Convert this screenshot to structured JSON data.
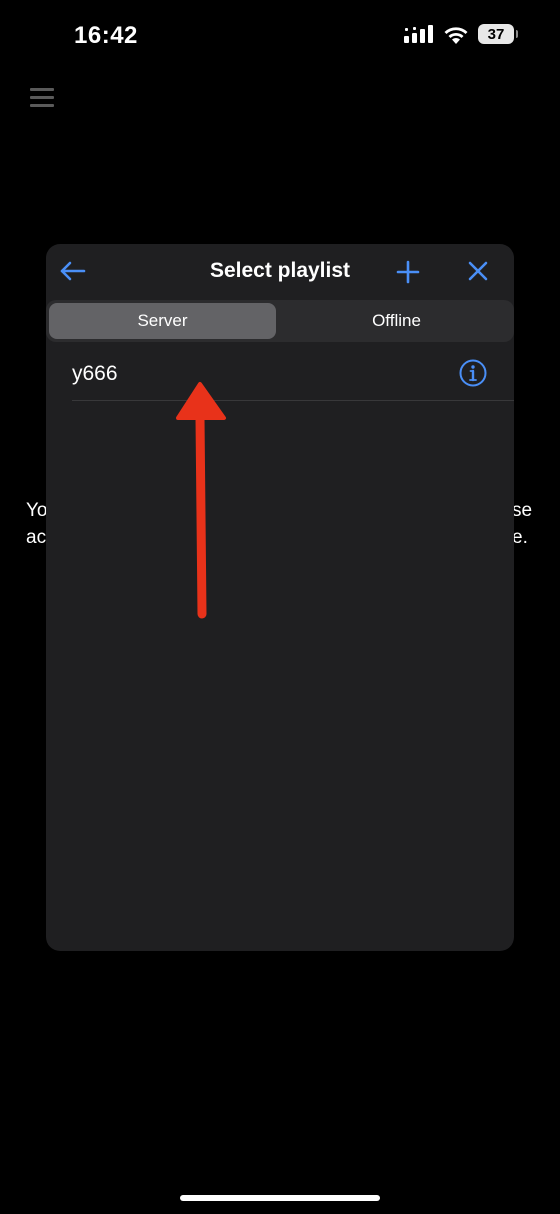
{
  "status_bar": {
    "time": "16:42",
    "battery": "37"
  },
  "background": {
    "text_left": "Yo\nac",
    "text_right": "se\ne."
  },
  "modal": {
    "title": "Select playlist",
    "tabs": [
      {
        "label": "Server",
        "active": true
      },
      {
        "label": "Offline",
        "active": false
      }
    ],
    "playlists": [
      {
        "name": "y666"
      }
    ]
  },
  "colors": {
    "accent": "#4a8ff7",
    "annotation": "#e8321a",
    "modal_bg": "#1f1f21"
  },
  "icons": {
    "back": "arrow-left-icon",
    "add": "plus-icon",
    "close": "close-icon",
    "info": "info-circle-icon",
    "menu": "hamburger-menu-icon"
  }
}
